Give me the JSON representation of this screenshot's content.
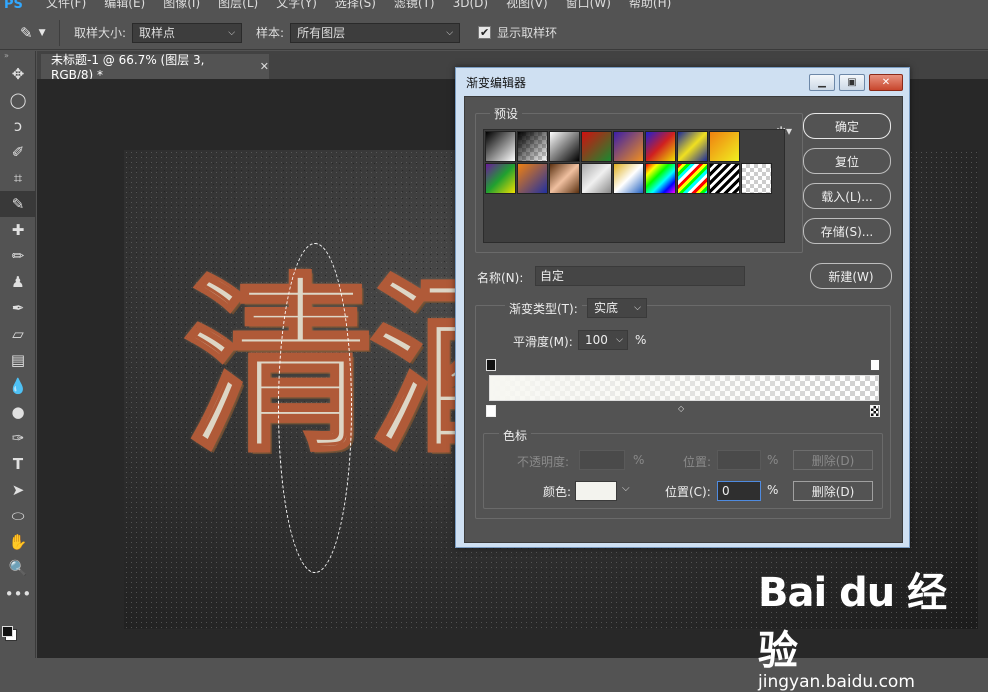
{
  "app": {
    "logo": "PS"
  },
  "menu": [
    "文件(F)",
    "编辑(E)",
    "图像(I)",
    "图层(L)",
    "文字(Y)",
    "选择(S)",
    "滤镜(T)",
    "3D(D)",
    "视图(V)",
    "窗口(W)",
    "帮助(H)"
  ],
  "options": {
    "sample_size_label": "取样大小:",
    "sample_size_value": "取样点",
    "sample_label": "样本:",
    "sample_value": "所有图层",
    "show_ring_label": "显示取样环",
    "show_ring_checked": true
  },
  "document": {
    "tab_title": "未标题-1 @ 66.7% (图层 3, RGB/8) *",
    "canvas_text": "清酒"
  },
  "tools": [
    "move-icon",
    "marquee-ellipse-icon",
    "lasso-icon",
    "quick-select-icon",
    "crop-icon",
    "eyedropper-icon",
    "healing-icon",
    "brush-icon",
    "stamp-icon",
    "history-brush-icon",
    "eraser-icon",
    "gradient-icon",
    "blur-icon",
    "dodge-icon",
    "pen-icon",
    "type-icon",
    "path-select-icon",
    "ellipse-icon",
    "hand-icon",
    "zoom-icon",
    "more-icon"
  ],
  "dialog": {
    "title": "渐变编辑器",
    "presets_label": "预设",
    "ok": "确定",
    "reset": "复位",
    "load": "载入(L)...",
    "save": "存储(S)...",
    "name_label": "名称(N):",
    "name_value": "自定",
    "new": "新建(W)",
    "gradient_type_label": "渐变类型(T):",
    "gradient_type_value": "实底",
    "smoothness_label": "平滑度(M):",
    "smoothness_value": "100",
    "percent": "%",
    "stops_label": "色标",
    "opacity_label": "不透明度:",
    "position_label": "位置:",
    "delete_label": "删除(D)",
    "color_label": "颜色:",
    "color_position_label": "位置(C):",
    "color_position_value": "0",
    "color_value": "#f3f3ee"
  },
  "watermark": {
    "logo": "Bai du 经验",
    "url": "jingyan.baidu.com"
  }
}
